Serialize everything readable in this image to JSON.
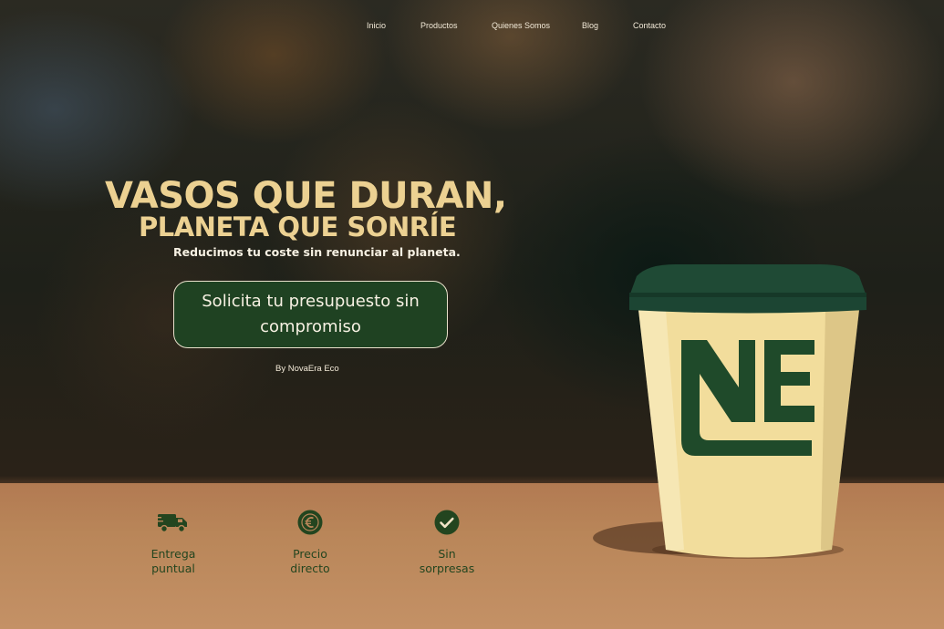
{
  "nav": {
    "items": [
      {
        "label": "Inicio"
      },
      {
        "label": "Productos"
      },
      {
        "label": "Quienes Somos"
      },
      {
        "label": "Blog"
      },
      {
        "label": "Contacto"
      }
    ]
  },
  "hero": {
    "headline_line1": "VASOS QUE DURAN,",
    "headline_line2": "PLANETA QUE SONRÍE",
    "subtitle": "Reducimos tu coste sin renunciar al planeta.",
    "cta_line1": "Solicita tu presupuesto sin",
    "cta_line2": "compromiso",
    "byline": "By NovaEra Eco"
  },
  "product": {
    "logo_text": "NE",
    "colors": {
      "cup": "#f2dd9c",
      "lid": "#1f4a35",
      "logo": "#1f4a2a"
    }
  },
  "features": [
    {
      "icon": "delivery-truck-icon",
      "line1": "Entrega",
      "line2": "puntual"
    },
    {
      "icon": "euro-icon",
      "line1": "Precio",
      "line2": "directo"
    },
    {
      "icon": "check-circle-icon",
      "line1": "Sin",
      "line2": "sorpresas"
    }
  ],
  "colors": {
    "accent": "#ecd192",
    "brand_green": "#1f4222",
    "feature_text": "#23451f",
    "table": "#b98659"
  }
}
